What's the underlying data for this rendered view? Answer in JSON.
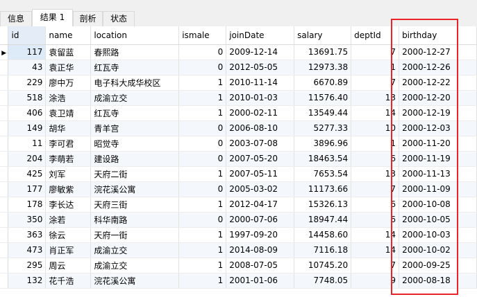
{
  "tabs": [
    "信息",
    "结果 1",
    "剖析",
    "状态"
  ],
  "columns": [
    "id",
    "name",
    "location",
    "ismale",
    "joinDate",
    "salary",
    "deptId",
    "birthday"
  ],
  "rows": [
    {
      "id": "117",
      "name": "袁留蓝",
      "location": "春熙路",
      "ismale": "0",
      "joinDate": "2009-12-14",
      "salary": "13691.75",
      "deptId": "7",
      "birthday": "2000-12-27"
    },
    {
      "id": "43",
      "name": "袁正华",
      "location": "红瓦寺",
      "ismale": "0",
      "joinDate": "2012-05-05",
      "salary": "12973.38",
      "deptId": "1",
      "birthday": "2000-12-26"
    },
    {
      "id": "229",
      "name": "廖中万",
      "location": "电子科大成华校区",
      "ismale": "1",
      "joinDate": "2010-11-14",
      "salary": "6670.89",
      "deptId": "7",
      "birthday": "2000-12-22"
    },
    {
      "id": "518",
      "name": "涂浩",
      "location": "成渝立交",
      "ismale": "1",
      "joinDate": "2010-01-03",
      "salary": "11576.40",
      "deptId": "13",
      "birthday": "2000-12-20"
    },
    {
      "id": "406",
      "name": "袁卫靖",
      "location": "红瓦寺",
      "ismale": "1",
      "joinDate": "2000-02-11",
      "salary": "13549.44",
      "deptId": "14",
      "birthday": "2000-12-19"
    },
    {
      "id": "149",
      "name": "胡华",
      "location": "青羊宫",
      "ismale": "0",
      "joinDate": "2006-08-10",
      "salary": "5277.33",
      "deptId": "10",
      "birthday": "2000-12-03"
    },
    {
      "id": "11",
      "name": "李可君",
      "location": "昭觉寺",
      "ismale": "0",
      "joinDate": "2003-07-08",
      "salary": "3896.96",
      "deptId": "1",
      "birthday": "2000-11-20"
    },
    {
      "id": "204",
      "name": "李萌若",
      "location": "建设路",
      "ismale": "0",
      "joinDate": "2007-05-20",
      "salary": "18463.54",
      "deptId": "6",
      "birthday": "2000-11-19"
    },
    {
      "id": "425",
      "name": "刘军",
      "location": "天府二街",
      "ismale": "1",
      "joinDate": "2007-05-11",
      "salary": "7653.54",
      "deptId": "13",
      "birthday": "2000-11-13"
    },
    {
      "id": "177",
      "name": "廖敏紫",
      "location": "浣花溪公寓",
      "ismale": "0",
      "joinDate": "2005-03-02",
      "salary": "11173.66",
      "deptId": "7",
      "birthday": "2000-11-09"
    },
    {
      "id": "178",
      "name": "李长达",
      "location": "天府三街",
      "ismale": "1",
      "joinDate": "2012-04-17",
      "salary": "15326.13",
      "deptId": "6",
      "birthday": "2000-10-08"
    },
    {
      "id": "350",
      "name": "涂若",
      "location": "科华南路",
      "ismale": "0",
      "joinDate": "2000-07-06",
      "salary": "18947.44",
      "deptId": "6",
      "birthday": "2000-10-05"
    },
    {
      "id": "363",
      "name": "徐云",
      "location": "天府一街",
      "ismale": "1",
      "joinDate": "1997-09-20",
      "salary": "14458.60",
      "deptId": "14",
      "birthday": "2000-10-03"
    },
    {
      "id": "473",
      "name": "肖正军",
      "location": "成渝立交",
      "ismale": "1",
      "joinDate": "2014-08-09",
      "salary": "7116.18",
      "deptId": "14",
      "birthday": "2000-10-02"
    },
    {
      "id": "295",
      "name": "周云",
      "location": "成渝立交",
      "ismale": "1",
      "joinDate": "2008-07-05",
      "salary": "10745.20",
      "deptId": "7",
      "birthday": "2000-09-25"
    },
    {
      "id": "132",
      "name": "花千浩",
      "location": "浣花溪公寓",
      "ismale": "1",
      "joinDate": "2001-01-06",
      "salary": "7748.05",
      "deptId": "9",
      "birthday": "2000-08-18"
    }
  ],
  "current_row_marker": "▶",
  "highlight_color": "#e8242a"
}
